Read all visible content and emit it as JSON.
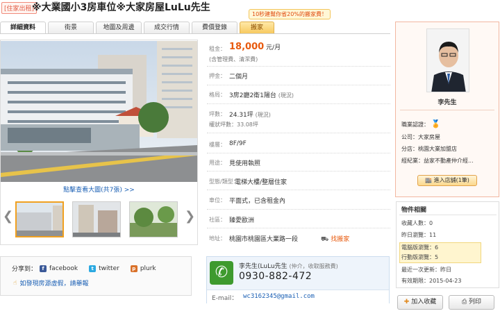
{
  "header": {
    "badge": "[住家出租]",
    "title": "※大業國小3房車位※大家房屋LuLu先生",
    "promo": "10秒建幫你省20%的搬家費！"
  },
  "tabs": [
    {
      "label": "詳細資料"
    },
    {
      "label": "街景"
    },
    {
      "label": "地圖及周邊"
    },
    {
      "label": "成交行情"
    },
    {
      "label": "費價登錄"
    },
    {
      "label": "搬家"
    }
  ],
  "gallery": {
    "link": "點擊查看大圖(共7張) >>",
    "prev": "❮",
    "next": "❯"
  },
  "share": {
    "label": "分享到：",
    "facebook": "facebook",
    "twitter": "twitter",
    "plurk": "plurk",
    "report": "如發現房源虛假，請舉報"
  },
  "specs": {
    "rent_label": "租金：",
    "rent_value": "18,000",
    "rent_unit": "元/月",
    "rent_note": "(含管理費、清潔費)",
    "deposit_label": "押金：",
    "deposit_value": "二個月",
    "layout_label": "格局：",
    "layout_value": "3房2廳2衛1陽台",
    "layout_note": "(現況)",
    "area_label": "坪數：",
    "area_value": "24.31坪",
    "area_note": "(現況)",
    "area_sub": "權狀坪數：33.08坪",
    "floor_label": "樓層：",
    "floor_value": "8F/9F",
    "usage_label": "用途：",
    "usage_value": "見使用執照",
    "type_label": "型態/類型：",
    "type_value": "電梯大樓/整層住家",
    "parking_label": "車位：",
    "parking_value": "平面式，已含租金內",
    "community_label": "社區：",
    "community_value": "臻愛歐洲",
    "address_label": "地址：",
    "address_value": "桃園市桃園區大業路一段",
    "mover_link": "找搬家"
  },
  "contact": {
    "name": "李先生(LuLu先生",
    "role": "(仲介，收取服務費)",
    "phone": "0930-882-472",
    "email_label": "E-mail：",
    "email": "wc3162345@gmail.com"
  },
  "agent": {
    "name": "李先生",
    "cert_label": "職業認證：",
    "company": "公司：大家房屋",
    "branch": "分店：桃園大業加盟店",
    "manager": "經紀業：益家不動產仲介經...",
    "store_button": "進入店舖(1筆)"
  },
  "stats": {
    "title": "物件相關",
    "favorites": "收藏人數：0",
    "yesterday": "昨日瀏覽：11",
    "pc_views": "電腦版瀏覽：6",
    "mobile_views": "行動版瀏覽：5",
    "last_update": "最近一次更新：昨日",
    "expiry": "有效期限：2015-04-23"
  },
  "actions": {
    "favorite": "加入收藏",
    "print": "列印"
  },
  "colors": {
    "price": "#e85a0e",
    "link": "#1a5fb4",
    "tab_alt": "#f6c75b"
  }
}
